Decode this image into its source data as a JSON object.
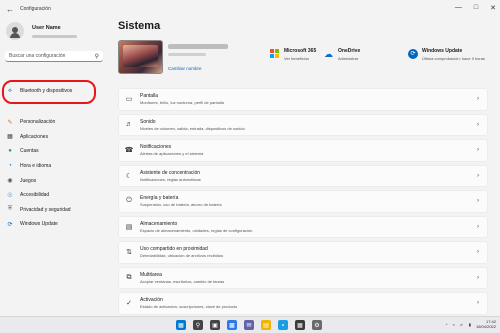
{
  "window": {
    "title": "Configuración",
    "back_icon": "back-arrow-icon"
  },
  "sidebar": {
    "user_name": "User Name",
    "search_placeholder": "Buscar una configuración",
    "highlighted_item": {
      "label": "Bluetooth y dispositivos",
      "icon": "bluetooth-icon"
    },
    "items": [
      {
        "label": "Personalización",
        "icon": "brush-icon",
        "color": "#d86e2b"
      },
      {
        "label": "Aplicaciones",
        "icon": "apps-icon",
        "color": "#444444"
      },
      {
        "label": "Cuentas",
        "icon": "account-icon",
        "color": "#1fa35a"
      },
      {
        "label": "Hora e idioma",
        "icon": "globe-clock-icon",
        "color": "#0067c0"
      },
      {
        "label": "Juegos",
        "icon": "gamepad-icon",
        "color": "#555555"
      },
      {
        "label": "Accesibilidad",
        "icon": "accessibility-icon",
        "color": "#0067c0"
      },
      {
        "label": "Privacidad y seguridad",
        "icon": "shield-icon",
        "color": "#666666"
      },
      {
        "label": "Windows Update",
        "icon": "windows-update-icon",
        "color": "#0067c0"
      }
    ]
  },
  "main": {
    "title": "Sistema",
    "rename_label": "Cambiar nombre",
    "status": [
      {
        "title": "Microsoft 365",
        "subtitle": "Ver beneficios",
        "icon": "microsoft-logo-icon"
      },
      {
        "title": "OneDrive",
        "subtitle": "Administrar",
        "icon": "cloud-icon"
      },
      {
        "title": "Windows Update",
        "subtitle": "Última comprobación: hace 9 horas",
        "icon": "windows-update-icon"
      }
    ],
    "cards": [
      {
        "title": "Pantalla",
        "subtitle": "Monitores, brillo, luz nocturna, perfil de pantalla",
        "icon": "monitor-icon"
      },
      {
        "title": "Sonido",
        "subtitle": "Niveles de volumen, salida, entrada, dispositivos de sonido",
        "icon": "speaker-icon"
      },
      {
        "title": "Notificaciones",
        "subtitle": "Alertas de aplicaciones y el sistema",
        "icon": "bell-icon"
      },
      {
        "title": "Asistente de concentración",
        "subtitle": "Notificaciones, reglas automáticas",
        "icon": "moon-icon"
      },
      {
        "title": "Energía y batería",
        "subtitle": "Suspensión, uso de batería, ahorro de batería",
        "icon": "power-icon"
      },
      {
        "title": "Almacenamiento",
        "subtitle": "Espacio de almacenamiento, unidades, reglas de configuración",
        "icon": "storage-icon"
      },
      {
        "title": "Uso compartido en proximidad",
        "subtitle": "Detectabilidad, ubicación de archivos recibidos",
        "icon": "share-icon"
      },
      {
        "title": "Multitarea",
        "subtitle": "Acoplar ventanas, escritorios, cambio de tareas",
        "icon": "multitask-icon"
      },
      {
        "title": "Activación",
        "subtitle": "Estado de activación, suscripciones, clave de producto",
        "icon": "check-circle-icon"
      }
    ]
  },
  "taskbar": {
    "apps": [
      {
        "icon": "windows-start-icon",
        "color": "#0078d4"
      },
      {
        "icon": "search-icon",
        "color": "#444444"
      },
      {
        "icon": "task-view-icon",
        "color": "#444444"
      },
      {
        "icon": "widgets-icon",
        "color": "#2c7be5"
      },
      {
        "icon": "chat-icon",
        "color": "#6264a7"
      },
      {
        "icon": "file-explorer-icon",
        "color": "#f0b400"
      },
      {
        "icon": "edge-icon",
        "color": "#1b9de2"
      },
      {
        "icon": "store-icon",
        "color": "#3a3a3a"
      },
      {
        "icon": "settings-gear-icon",
        "color": "#6b6b6b"
      }
    ],
    "tray_chevron": "^",
    "clock_time": "17:42",
    "clock_date": "16/04/2022"
  }
}
